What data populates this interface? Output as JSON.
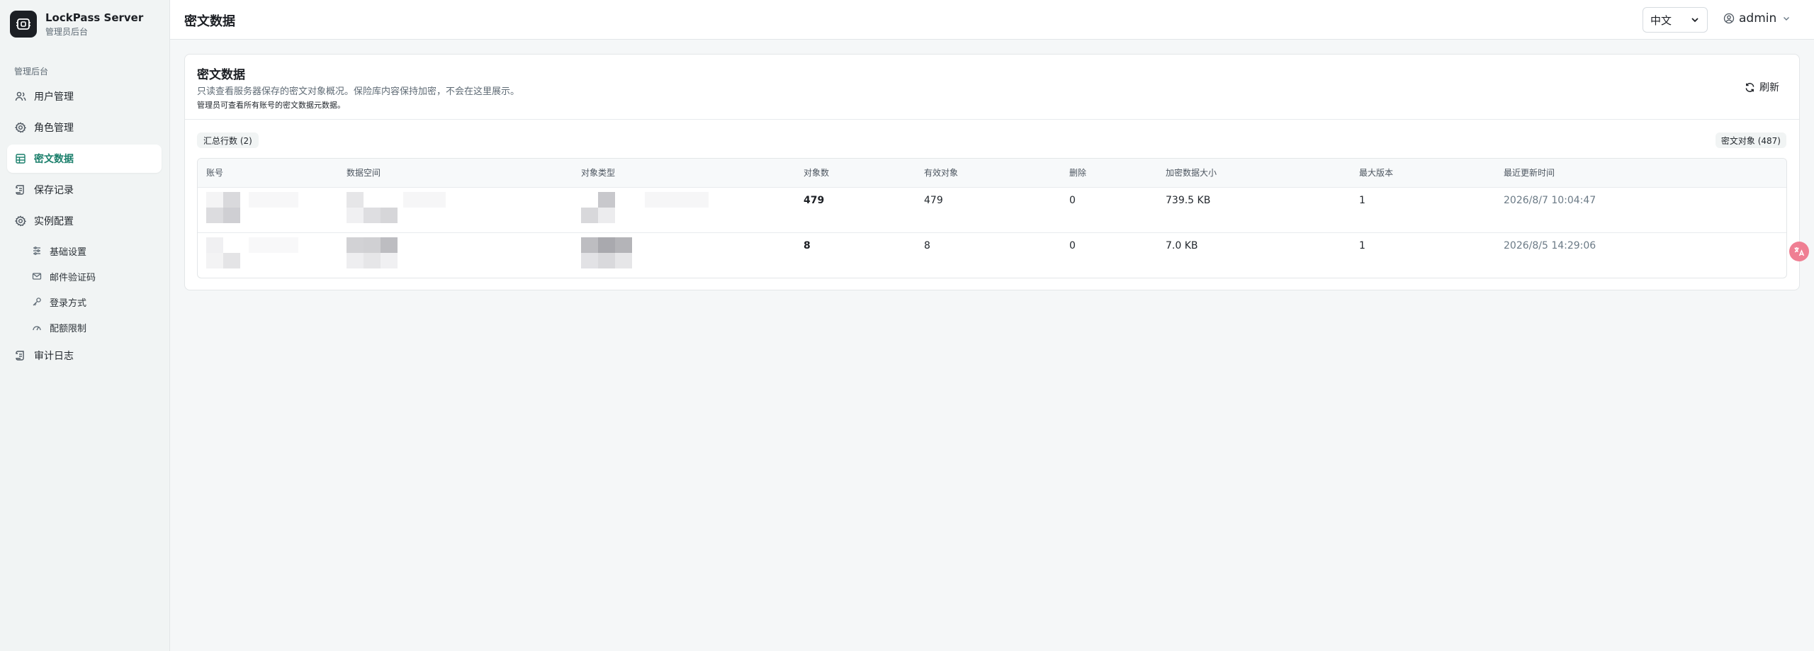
{
  "app": {
    "name": "LockPass Server",
    "subtitle": "管理员后台"
  },
  "sidebar": {
    "section_label": "管理后台",
    "items": [
      {
        "label": "用户管理",
        "icon": "users-icon"
      },
      {
        "label": "角色管理",
        "icon": "gear-icon"
      },
      {
        "label": "密文数据",
        "icon": "table-icon",
        "active": true
      },
      {
        "label": "保存记录",
        "icon": "scroll-icon"
      },
      {
        "label": "实例配置",
        "icon": "gear-icon"
      }
    ],
    "sub_items": [
      {
        "label": "基础设置",
        "icon": "sliders-icon"
      },
      {
        "label": "邮件验证码",
        "icon": "mail-icon"
      },
      {
        "label": "登录方式",
        "icon": "key-icon"
      },
      {
        "label": "配额限制",
        "icon": "gauge-icon"
      }
    ],
    "audit": {
      "label": "审计日志",
      "icon": "scroll-icon"
    }
  },
  "header": {
    "title": "密文数据",
    "language": "中文",
    "user": "admin"
  },
  "card": {
    "title": "密文数据",
    "description": "只读查看服务器保存的密文对象概况。保险库内容保持加密，不会在这里展示。",
    "note": "管理员可查看所有账号的密文数据元数据。",
    "refresh_label": "刷新",
    "summary_badge": "汇总行数 (2)",
    "objects_badge": "密文对象 (487)"
  },
  "table": {
    "columns": [
      "账号",
      "数据空间",
      "对象类型",
      "对象数",
      "有效对象",
      "删除",
      "加密数据大小",
      "最大版本",
      "最近更新时间"
    ],
    "rows": [
      {
        "objects": "479",
        "active": "479",
        "deleted": "0",
        "size": "739.5 KB",
        "max_version": "1",
        "updated": "2026/8/7 10:04:47"
      },
      {
        "objects": "8",
        "active": "8",
        "deleted": "0",
        "size": "7.0 KB",
        "max_version": "1",
        "updated": "2026/8/5 14:29:06"
      }
    ]
  },
  "colors": {
    "accent": "#1a7f6b",
    "sidebar_bg": "#f1f4f4",
    "page_bg": "#f5f7f8",
    "float_icon": "#ef7f93"
  }
}
